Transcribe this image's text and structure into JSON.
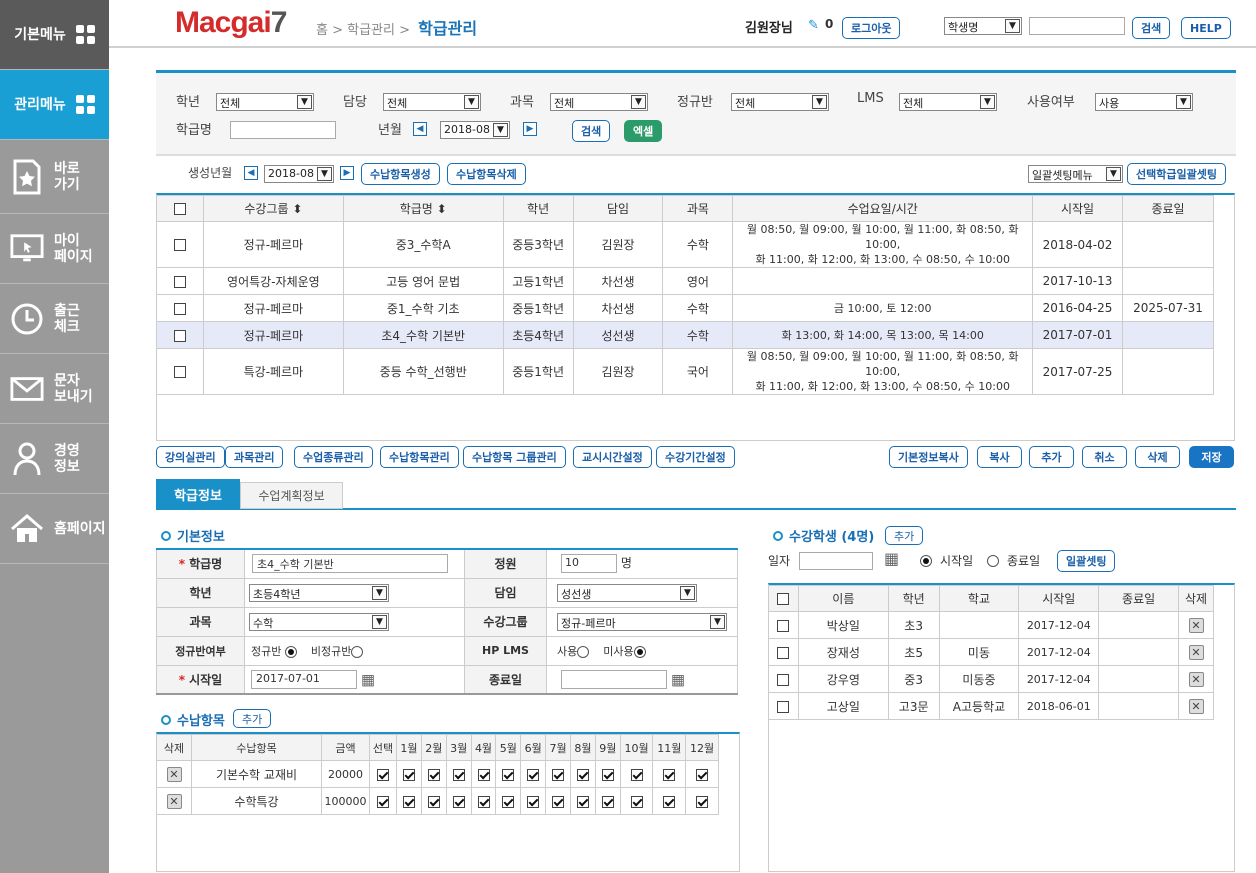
{
  "sidebar": {
    "top": "기본메뉴",
    "active": "관리메뉴",
    "items": [
      {
        "label": "바로\n가기",
        "icon": "bookmark-icon"
      },
      {
        "label": "마이\n페이지",
        "icon": "monitor-icon"
      },
      {
        "label": "출근\n체크",
        "icon": "clock-icon"
      },
      {
        "label": "문자\n보내기",
        "icon": "mail-icon"
      },
      {
        "label": "경영\n정보",
        "icon": "person-icon"
      },
      {
        "label": "홈페이지",
        "icon": "home-icon"
      }
    ]
  },
  "header": {
    "logo_main": "Macgai",
    "logo_num": "7",
    "breadcrumb": [
      "홈",
      "학급관리"
    ],
    "current": "학급관리",
    "user": "김원장님",
    "msg_count": "0",
    "logout": "로그아웃",
    "search_select": "학생명",
    "search_value": "",
    "search_button": "검색",
    "help_button": "HELP"
  },
  "filter": {
    "grade_label": "학년",
    "grade_value": "전체",
    "manager_label": "담당",
    "manager_value": "전체",
    "subject_label": "과목",
    "subject_value": "전체",
    "regular_label": "정규반",
    "regular_value": "전체",
    "lms_label": "LMS",
    "lms_value": "전체",
    "use_label": "사용여부",
    "use_value": "사용",
    "class_name_label": "학급명",
    "class_name_value": "",
    "month_label": "년월",
    "month_value": "2018-08",
    "search_button": "검색",
    "excel_button": "엑셀"
  },
  "toolbar": {
    "gen_label": "생성년월",
    "gen_value": "2018-08",
    "create_button": "수납항목생성",
    "delete_button": "수납항목삭제",
    "bulk_menu": "일괄셋팅메뉴",
    "bulk_button": "선택학급일괄셋팅"
  },
  "class_table": {
    "headers": [
      "수강그룹",
      "학급명",
      "학년",
      "담임",
      "과목",
      "수업요일/시간",
      "시작일",
      "종료일"
    ],
    "rows": [
      {
        "group": "정규-페르마",
        "name": "중3_수학A",
        "grade": "중등3학년",
        "teacher": "김원장",
        "subject": "수학",
        "schedule1": "월 08:50, 월 09:00, 월 10:00, 월 11:00, 화 08:50, 화 10:00,",
        "schedule2": "화 11:00, 화 12:00, 화 13:00, 수 08:50, 수 10:00",
        "start": "2018-04-02",
        "end": ""
      },
      {
        "group": "영어특강-자체운영",
        "name": "고등 영어 문법",
        "grade": "고등1학년",
        "teacher": "차선생",
        "subject": "영어",
        "schedule1": "",
        "schedule2": "",
        "start": "2017-10-13",
        "end": ""
      },
      {
        "group": "정규-페르마",
        "name": "중1_수학 기초",
        "grade": "중등1학년",
        "teacher": "차선생",
        "subject": "수학",
        "schedule1": "금 10:00, 토 12:00",
        "schedule2": "",
        "start": "2016-04-25",
        "end": "2025-07-31"
      },
      {
        "group": "정규-페르마",
        "name": "초4_수학 기본반",
        "grade": "초등4학년",
        "teacher": "성선생",
        "subject": "수학",
        "schedule1": "화 13:00, 화 14:00, 목 13:00, 목 14:00",
        "schedule2": "",
        "start": "2017-07-01",
        "end": ""
      },
      {
        "group": "특강-페르마",
        "name": "중등 수학_선행반",
        "grade": "중등1학년",
        "teacher": "김원장",
        "subject": "국어",
        "schedule1": "월 08:50, 월 09:00, 월 10:00, 월 11:00, 화 08:50, 화 10:00,",
        "schedule2": "화 11:00, 화 12:00, 화 13:00, 수 08:50, 수 10:00",
        "start": "2017-07-25",
        "end": ""
      }
    ]
  },
  "actions": {
    "left": [
      "강의실관리",
      "과목관리",
      "수업종류관리",
      "수납항목관리",
      "수납항목 그룹관리",
      "교시시간설정",
      "수강기간설정"
    ],
    "right": [
      "기본정보복사",
      "복사",
      "추가",
      "취소",
      "삭제",
      "저장"
    ]
  },
  "tabs": [
    "학급정보",
    "수업계획정보"
  ],
  "basic": {
    "title": "기본정보",
    "name_label": "학급명",
    "name_value": "초4_수학 기본반",
    "capacity_label": "정원",
    "capacity_value": "10",
    "capacity_unit": "명",
    "grade_label": "학년",
    "grade_value": "초등4학년",
    "teacher_label": "담임",
    "teacher_value": "성선생",
    "subject_label": "과목",
    "subject_value": "수학",
    "group_label": "수강그룹",
    "group_value": "정규-페르마",
    "regular_label": "정규반여부",
    "regular_opt1": "정규반",
    "regular_opt2": "비정규반",
    "lms_label": "HP LMS",
    "lms_opt1": "사용",
    "lms_opt2": "미사용",
    "start_label": "시작일",
    "start_value": "2017-07-01",
    "end_label": "종료일",
    "end_value": ""
  },
  "fees": {
    "title": "수납항목",
    "add": "추가",
    "headers": [
      "삭제",
      "수납항목",
      "금액",
      "선택",
      "1월",
      "2월",
      "3월",
      "4월",
      "5월",
      "6월",
      "7월",
      "8월",
      "9월",
      "10월",
      "11월",
      "12월"
    ],
    "rows": [
      {
        "name": "기본수학 교재비",
        "amount": "20000"
      },
      {
        "name": "수학특강",
        "amount": "100000"
      }
    ]
  },
  "students": {
    "title": "수강학생 (4명)",
    "add": "추가",
    "date_label": "일자",
    "date_value": "",
    "opt_start": "시작일",
    "opt_end": "종료일",
    "bulk_button": "일괄셋팅",
    "headers": [
      "이름",
      "학년",
      "학교",
      "시작일",
      "종료일",
      "삭제"
    ],
    "rows": [
      {
        "name": "박상일",
        "grade": "초3",
        "school": "",
        "start": "2017-12-04",
        "end": ""
      },
      {
        "name": "장재성",
        "grade": "초5",
        "school": "미동",
        "start": "2017-12-04",
        "end": ""
      },
      {
        "name": "강우영",
        "grade": "중3",
        "school": "미동중",
        "start": "2017-12-04",
        "end": ""
      },
      {
        "name": "고상일",
        "grade": "고3문",
        "school": "A고등학교",
        "start": "2018-06-01",
        "end": ""
      }
    ]
  }
}
